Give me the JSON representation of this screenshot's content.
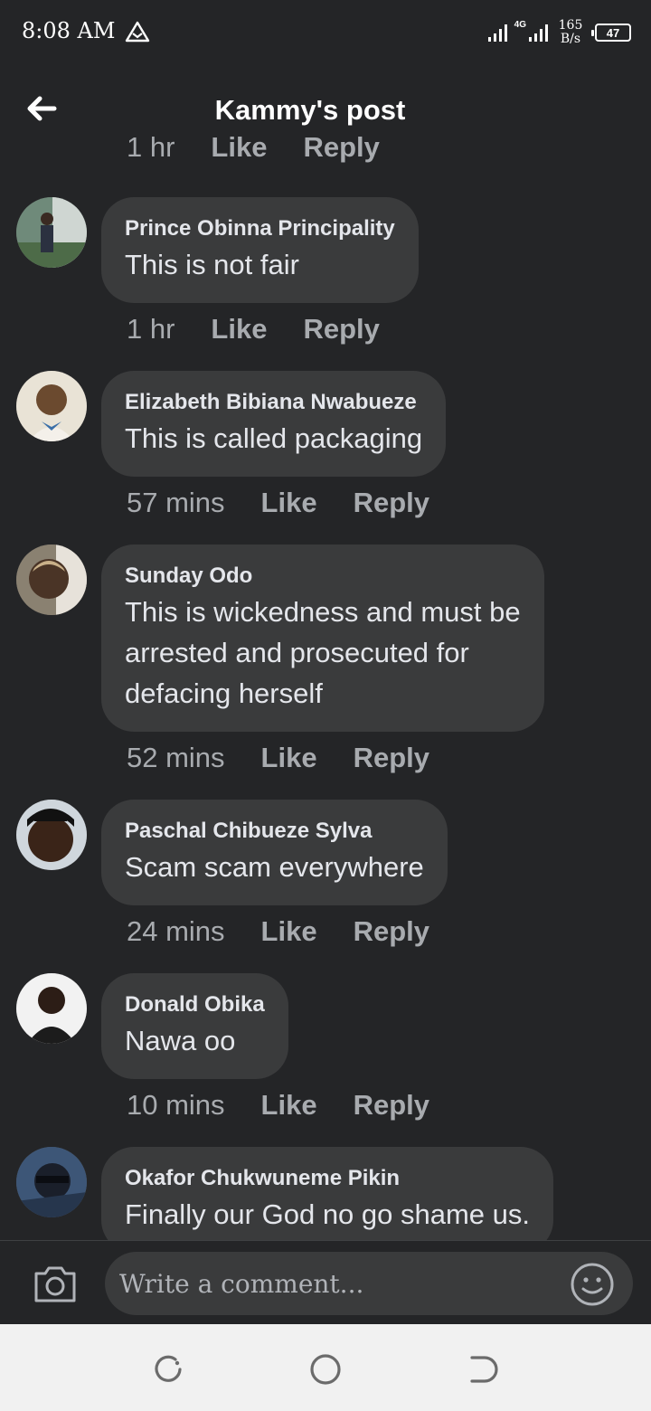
{
  "status_bar": {
    "time": "8:08 AM",
    "network": "4G",
    "speed_value": "165",
    "speed_unit": "B/s",
    "battery": "47",
    "icons": [
      "alert-triangle-icon",
      "signal-icon",
      "signal-icon",
      "battery-icon"
    ]
  },
  "header": {
    "title": "Kammy's post",
    "back_icon": "back-arrow-icon"
  },
  "partial_meta": {
    "time": "1 hr",
    "like": "Like",
    "reply": "Reply"
  },
  "comments": [
    {
      "author": "Prince Obinna Principality",
      "lines": [
        "This is not fair"
      ],
      "time": "1 hr",
      "like": "Like",
      "reply": "Reply"
    },
    {
      "author": "Elizabeth Bibiana Nwabueze",
      "lines": [
        "This is called packaging"
      ],
      "time": "57 mins",
      "like": "Like",
      "reply": "Reply"
    },
    {
      "author": "Sunday Odo",
      "lines": [
        "This is wickedness and must be",
        "arrested and prosecuted for",
        "defacing herself"
      ],
      "time": "52 mins",
      "like": "Like",
      "reply": "Reply"
    },
    {
      "author": "Paschal Chibueze Sylva",
      "lines": [
        "Scam scam everywhere"
      ],
      "time": "24 mins",
      "like": "Like",
      "reply": "Reply"
    },
    {
      "author": "Donald Obika",
      "lines": [
        "Nawa oo"
      ],
      "time": "10 mins",
      "like": "Like",
      "reply": "Reply"
    },
    {
      "author": "Okafor Chukwuneme Pikin",
      "lines": [
        "Finally our God no go shame us."
      ]
    }
  ],
  "composer": {
    "placeholder": "Write a comment...",
    "camera_icon": "camera-icon",
    "emoji_icon": "emoji-icon"
  },
  "navbar": {
    "icons": [
      "recent-apps-icon",
      "home-icon",
      "back-icon"
    ]
  },
  "colors": {
    "background": "#242527",
    "bubble": "#3a3b3c",
    "text": "#e4e6eb",
    "muted": "#a8abaf"
  }
}
